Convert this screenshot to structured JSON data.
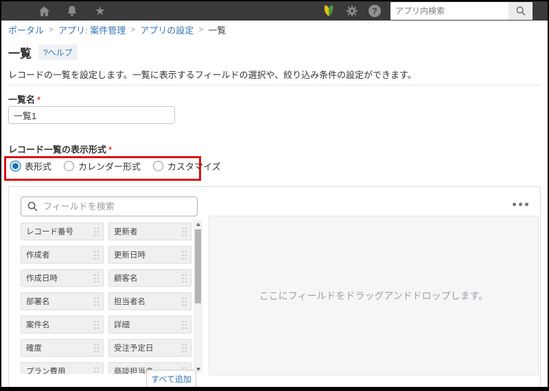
{
  "header": {
    "search_placeholder": "アプリ内検索",
    "icons": [
      "menu-icon",
      "home-icon",
      "notification-bell-icon",
      "star-icon",
      "beginner-mark-icon",
      "gear-icon",
      "help-icon",
      "search-icon"
    ]
  },
  "breadcrumb": {
    "separator": ">",
    "items": [
      {
        "label": "ポータル",
        "link": true
      },
      {
        "label": "アプリ: 案件管理",
        "link": true
      },
      {
        "label": "アプリの設定",
        "link": true
      },
      {
        "label": "一覧",
        "link": false
      }
    ]
  },
  "page": {
    "title": "一覧",
    "help_label": "?ヘルプ",
    "description": "レコードの一覧を設定します。一覧に表示するフィールドの選択や、絞り込み条件の設定ができます。"
  },
  "form": {
    "list_name": {
      "label": "一覧名",
      "required_mark": "*",
      "value": "一覧1"
    },
    "display_format": {
      "label": "レコード一覧の表示形式",
      "required_mark": "*",
      "options": [
        {
          "label": "表形式",
          "selected": true
        },
        {
          "label": "カレンダー形式",
          "selected": false
        },
        {
          "label": "カスタマイズ",
          "selected": false
        }
      ]
    }
  },
  "field_picker": {
    "search_placeholder": "フィールドを検索",
    "fields_col1": [
      "レコード番号",
      "作成者",
      "作成日時",
      "部署名",
      "案件名",
      "確度",
      "プラン費用"
    ],
    "fields_col2": [
      "更新者",
      "更新日時",
      "顧客名",
      "担当者名",
      "詳細",
      "受注予定日",
      "商談担当者"
    ],
    "add_all_label": "すべて追加",
    "dropzone_text": "ここにフィールドをドラッグアンドドロップします。"
  },
  "colors": {
    "header_bg": "#3a3a3a",
    "link_blue": "#3373b5",
    "required_red": "#e74c3c",
    "annotation_red": "#dd0c0c",
    "radio_selected_blue": "#1a6fba",
    "chip_bg": "#f0f0f0",
    "dropzone_bg": "#f5f6f8"
  }
}
